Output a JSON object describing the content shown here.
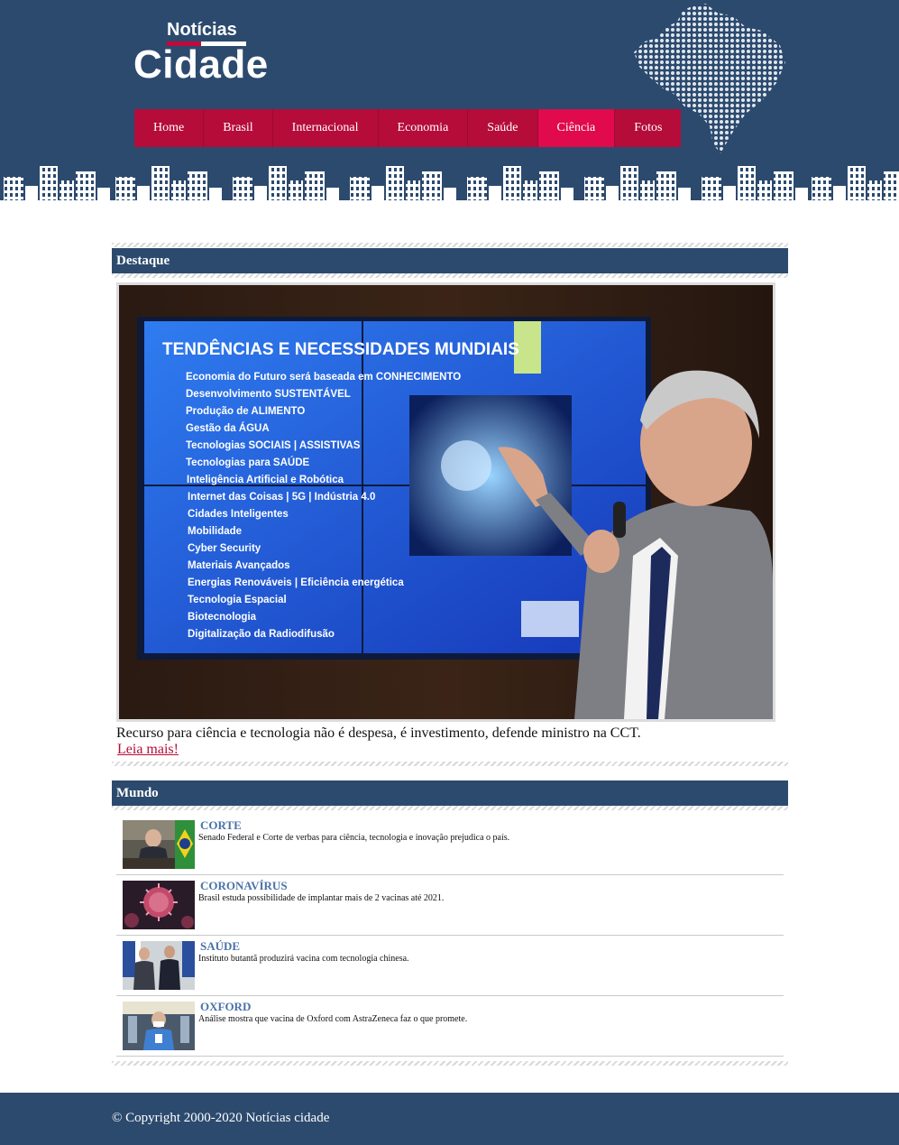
{
  "site": {
    "logo_top": "Notícias",
    "logo_main": "Cidade"
  },
  "nav": {
    "items": [
      "Home",
      "Brasil",
      "Internacional",
      "Economia",
      "Saúde",
      "Ciência",
      "Fotos"
    ],
    "active": "Ciência"
  },
  "featured": {
    "section_title": "Destaque",
    "caption": "Recurso para ciência e tecnologia não é despesa, é investimento, defende ministro na CCT.",
    "link_label": "Leia mais!",
    "slide": {
      "heading": "TENDÊNCIAS E NECESSIDADES MUNDIAIS",
      "bullets": [
        "Economia do Futuro será baseada em CONHECIMENTO",
        "Desenvolvimento SUSTENTÁVEL",
        "Produção de ALIMENTO",
        "Gestão da ÁGUA",
        "Tecnologias SOCIAIS | ASSISTIVAS",
        "Tecnologias para SAÚDE",
        "Inteligência Artificial e Robótica",
        "Internet das Coisas | 5G | Indústria 4.0",
        "Cidades Inteligentes",
        "Mobilidade",
        "Cyber Security",
        "Materiais Avançados",
        "Energias Renováveis | Eficiência energética",
        "Tecnologia Espacial",
        "Biotecnologia",
        "Digitalização da Radiodifusão"
      ]
    }
  },
  "world": {
    "section_title": "Mundo",
    "items": [
      {
        "title": "CORTE",
        "text": "Senado Federal e Corte de verbas para ciência, tecnologia e inovação prejudica o país.",
        "thumb": "senate-photo"
      },
      {
        "title": "CORONAVÍRUS",
        "text": "Brasil estuda possibilidade de implantar mais de 2 vacinas até 2021.",
        "thumb": "virus-photo"
      },
      {
        "title": "SAÚDE",
        "text": "Instituto butantã produzirá vacina com tecnologia chinesa.",
        "thumb": "officials-photo"
      },
      {
        "title": "OXFORD",
        "text": "Análise mostra que vacina de Oxford com AstraZeneca faz o que promete.",
        "thumb": "lab-photo"
      }
    ]
  },
  "footer": {
    "copyright": "© Copyright 2000-2020 Notícias cidade"
  },
  "colors": {
    "header_bg": "#2c4a6e",
    "nav_bg": "#b50c3a",
    "nav_active": "#e00a4c",
    "link": "#b50c3a",
    "news_title": "#4a72a8"
  }
}
